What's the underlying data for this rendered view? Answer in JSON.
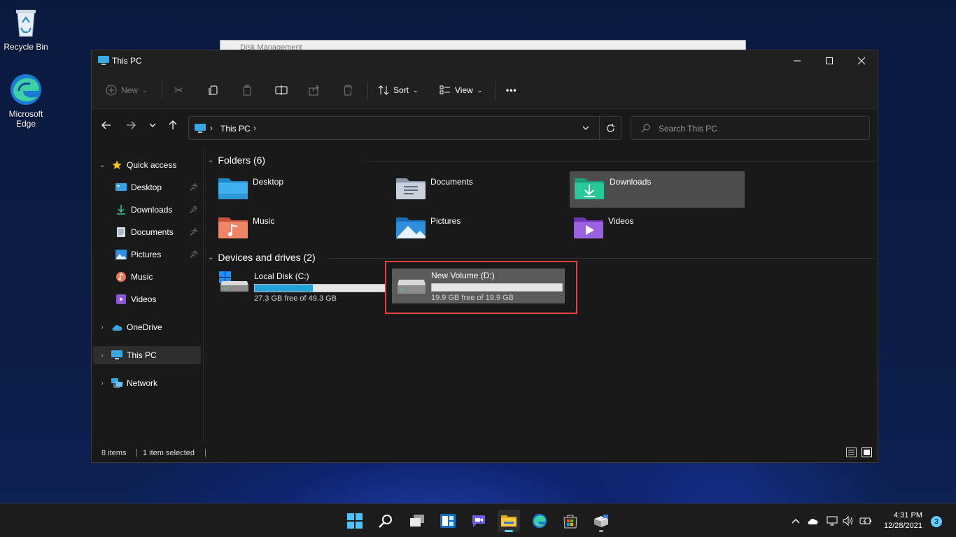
{
  "desktop": {
    "icons": [
      {
        "label": "Recycle Bin",
        "icon": "recycle-bin-icon"
      },
      {
        "label": "Microsoft Edge",
        "icon": "edge-icon"
      }
    ],
    "background_window_title": "Disk Management"
  },
  "window": {
    "title": "This PC",
    "controls": {
      "minimize": "minimize",
      "maximize": "maximize",
      "close": "close"
    }
  },
  "toolbar": {
    "new_label": "New",
    "sort_label": "Sort",
    "view_label": "View",
    "more_label": "•••"
  },
  "address": {
    "path": "This PC",
    "separator": "›"
  },
  "search": {
    "placeholder": "Search This PC"
  },
  "nav": {
    "quick_access": "Quick access",
    "items": [
      {
        "label": "Desktop",
        "pinned": true
      },
      {
        "label": "Downloads",
        "pinned": true
      },
      {
        "label": "Documents",
        "pinned": true
      },
      {
        "label": "Pictures",
        "pinned": true
      },
      {
        "label": "Music",
        "pinned": false
      },
      {
        "label": "Videos",
        "pinned": false
      }
    ],
    "onedrive": "OneDrive",
    "this_pc": "This PC",
    "network": "Network"
  },
  "content": {
    "folders_header": "Folders (6)",
    "folders": [
      {
        "label": "Desktop",
        "selected": false
      },
      {
        "label": "Documents",
        "selected": false
      },
      {
        "label": "Downloads",
        "selected": true
      },
      {
        "label": "Music",
        "selected": false
      },
      {
        "label": "Pictures",
        "selected": false
      },
      {
        "label": "Videos",
        "selected": false
      }
    ],
    "drives_header": "Devices and drives (2)",
    "drives": [
      {
        "name": "Local Disk (C:)",
        "free_text": "27.3 GB free of 49.3 GB",
        "used_fraction": 0.446,
        "selected": false
      },
      {
        "name": "New Volume (D:)",
        "free_text": "19.9 GB free of 19.9 GB",
        "used_fraction": 0.0,
        "selected": true
      }
    ]
  },
  "status": {
    "items_count": "8 items",
    "selected_count": "1 item selected"
  },
  "taskbar": {
    "apps": [
      "start-icon",
      "search-icon",
      "task-view-icon",
      "widgets-icon",
      "chat-icon",
      "file-explorer-icon",
      "edge-icon",
      "store-icon",
      "installer-icon"
    ],
    "time": "4:31 PM",
    "date": "12/28/2021",
    "notification_count": "3"
  },
  "colors": {
    "accent": "#26a0da",
    "highlight_box": "#e0443e",
    "selection": "#4d4d4d"
  }
}
